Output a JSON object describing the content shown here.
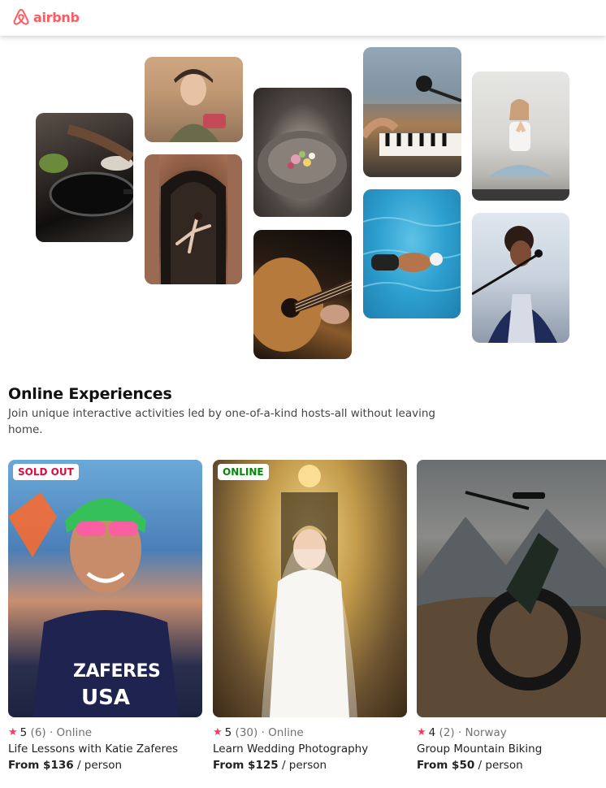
{
  "header": {
    "logo_text": "airbnb",
    "brand_color": "#FF5A5F"
  },
  "mosaic": {
    "tiles": [
      {
        "name": "cooking-photo",
        "icon": "pan-icon"
      },
      {
        "name": "portrait-woman-photo",
        "icon": "person-icon"
      },
      {
        "name": "dancer-photo",
        "icon": "dancer-icon"
      },
      {
        "name": "food-bowl-photo",
        "icon": "bowl-icon"
      },
      {
        "name": "guitar-photo",
        "icon": "guitar-icon"
      },
      {
        "name": "microphone-piano-photo",
        "icon": "microphone-icon"
      },
      {
        "name": "swimmer-photo",
        "icon": "swimmer-icon"
      },
      {
        "name": "yoga-photo",
        "icon": "yoga-icon"
      },
      {
        "name": "singer-photo",
        "icon": "singer-icon"
      }
    ]
  },
  "section": {
    "title": "Online Experiences",
    "subtitle": "Join unique interactive activities led by one-of-a-kind hosts-all without leaving home."
  },
  "cards": [
    {
      "badge": "SOLD OUT",
      "badge_color": "#E00B41",
      "rating": "5",
      "reviews": "(6)",
      "location": "· Online",
      "title": "Life Lessons with Katie Zaferes",
      "price": "From $136",
      "per": "/ person",
      "shirt_text_1": "ZAFERES",
      "shirt_text_2": "USA"
    },
    {
      "badge": "ONLINE",
      "badge_color": "#008A05",
      "rating": "5",
      "reviews": "(30)",
      "location": "· Online",
      "title": "Learn Wedding Photography",
      "price": "From $125",
      "per": "/ person"
    },
    {
      "badge": "",
      "rating": "4",
      "reviews": "(2)",
      "location": "· Norway",
      "title": "Group Mountain Biking",
      "price": "From $50",
      "per": "/ person"
    }
  ],
  "colors": {
    "star": "#FF385C",
    "text": "#222222",
    "muted": "#717171"
  }
}
